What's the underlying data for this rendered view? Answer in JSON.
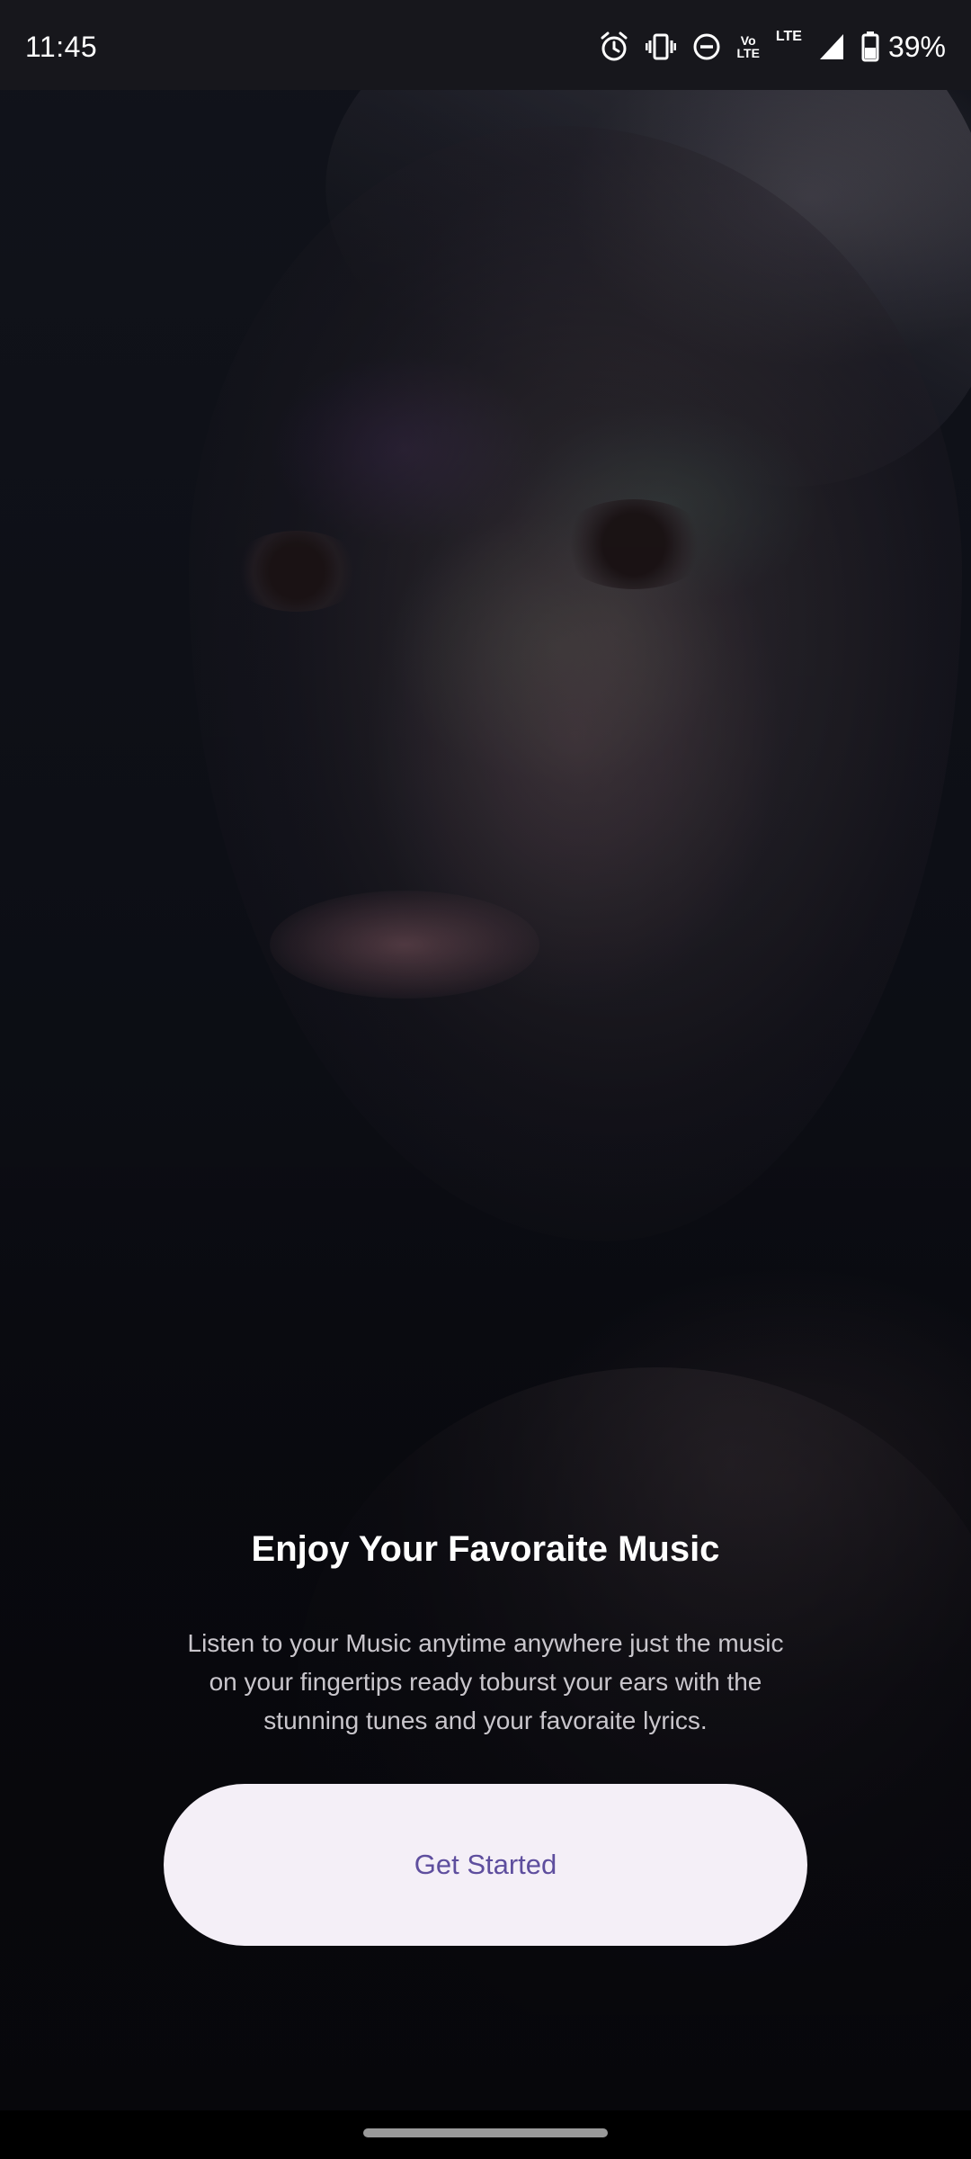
{
  "status_bar": {
    "time": "11:45",
    "icons": [
      "alarm-icon",
      "vibrate-icon",
      "do-not-disturb-icon",
      "volte-icon",
      "lte-icon",
      "signal-icon",
      "battery-icon"
    ],
    "volte_label_top": "Vo",
    "volte_label_bottom": "LTE",
    "lte_label": "LTE",
    "battery_percent": "39%"
  },
  "onboarding": {
    "title": "Enjoy Your Favoraite Music",
    "description": "Listen to your Music anytime anywhere just the music on your fingertips ready toburst your ears with the stunning tunes and your favoraite lyrics.",
    "cta_label": "Get Started"
  },
  "colors": {
    "status_bar_bg": "#17171c",
    "cta_bg": "#f4eff7",
    "cta_text": "#5e4e9e",
    "title_text": "#ffffff",
    "body_text": "#c9c6cc"
  }
}
